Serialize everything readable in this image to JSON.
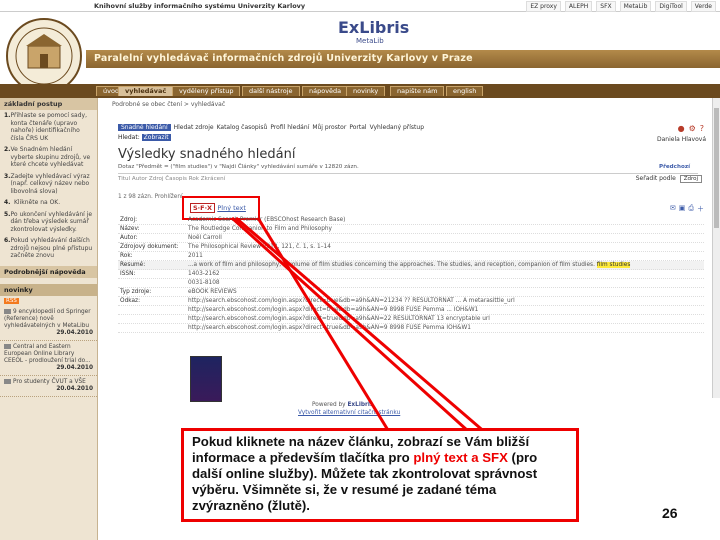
{
  "topbar": {
    "title": "Knihovní služby informačního systému Univerzity Karlovy",
    "links": [
      "EZ proxy",
      "ALEPH",
      "SFX",
      "MetaLib",
      "DigiTool",
      "Verde"
    ]
  },
  "header": {
    "brand": "ExLibris",
    "brand_sub": "MetaLib",
    "banner": "Paralelní vyhledávač informačních zdrojů Univerzity Karlovy v Praze"
  },
  "nav": {
    "tabs": [
      "úvod",
      "vyhledávač",
      "vydělený přístup",
      "další nástroje",
      "nápověda",
      "novinky",
      "napište nám",
      "english"
    ],
    "active_index": 1
  },
  "sidebar": {
    "heading": "základní postup",
    "steps": [
      {
        "n": "1.",
        "text": "Přihlaste se pomocí sady, konta čtenáře (upravo nahoře) identifikačního čísla ČRS UK"
      },
      {
        "n": "2.",
        "text": "Ve Snadném hledání vyberte skupinu zdrojů, ve které chcete vyhledávat"
      },
      {
        "n": "3.",
        "text": "Zadejte vyhledávací výraz (např. celkový název nebo libovolná slova)"
      },
      {
        "n": "4.",
        "text": "Klikněte na OK."
      },
      {
        "n": "5.",
        "text": "Po ukončení vyhledávání je dán třeba výsledek sumář zkontrolovat výsledky."
      },
      {
        "n": "6.",
        "text": "Pokud vyhledávání dalších zdrojů nejsou plné přístupu začněte znovu"
      }
    ],
    "help_heading": "Podrobnější nápověda",
    "news_heading": "novinky",
    "rss": "RSS",
    "news": [
      {
        "text": "9 encyklopedií od Springer (Reference) nově vyhledávatelných v MetaLibu",
        "date": "29.04.2010"
      },
      {
        "text": "Central and Eastern European Online Library CEEOL - prodloužení trial do...",
        "date": "29.04.2010"
      },
      {
        "text": "Pro studenty ČVUT a VŠE",
        "date": "20.04.2010"
      }
    ]
  },
  "main": {
    "breadcrumb": "Podrobné se obec čtení > vyhledávač",
    "view_links": [
      "Snadné hledání",
      "Hledat zdroje",
      "Katalog časopisů",
      "Profil hledání",
      "Můj prostor",
      "Portal",
      "Vyhledaný přístup"
    ],
    "hidden_label": "Hledat:",
    "hidden_box": "Zobrazit",
    "username": "Daniela Hlavová",
    "page_title": "Výsledky snadného hledání",
    "query_text": "Dotaz \"Předmět = (\"film studies\") v \"Najdi Články\" vyhledávání sumáře v 12820 zázn.",
    "prev_label": "Předchozí",
    "filter_text": "Titul Autor Zdroj Časopis Rok Zkrácení",
    "sort_label": "Seřadit podle",
    "sort_value": "Zdroj",
    "counts": "1 z 98 zázn. Prohlížení",
    "sfx_label": "S·F·X",
    "fulltext_label": "Plný text",
    "record": [
      {
        "label": "Zdroj:",
        "value": "Academic Search Premier (EBSCOhost Research Base)"
      },
      {
        "label": "Název:",
        "value": "The Routledge Companion to Film and Philosophy"
      },
      {
        "label": "Autor:",
        "value": "Noël Carroll"
      },
      {
        "label": "Zdrojový dokument:",
        "value": "The Philosophical Review 2012, 121, č. 1, s. 1–14"
      },
      {
        "label": "Rok:",
        "value": "2011"
      },
      {
        "label": "Resumé:",
        "value": "...a work of film and philosophy, a volume of film studies concerning the approaches. The studies, and reception, companion of film studies.",
        "highlight": "film studies"
      },
      {
        "label": "ISSN:",
        "value": "1403-2162"
      },
      {
        "label": "",
        "value": "0031-8108"
      },
      {
        "label": "Typ zdroje:",
        "value": "eBOOK REVIEWS"
      },
      {
        "label": "Odkaz:",
        "value": "http://search.ebscohost.com/login.aspx?direct=true&db=a9h&AN=21234 ?? RESULTORNAT ... A metarasittle_url"
      },
      {
        "label": "",
        "value": "http://search.ebscohost.com/login.aspx?direct=true&db=a9h&AN=9 8998 FUSE Pemma ... IOH&W1"
      },
      {
        "label": "",
        "value": "http://search.ebscohost.com/login.aspx?direct=true&db=a9h&AN=22 RESULTORNAT 13 encryptable url"
      },
      {
        "label": "",
        "value": "http://search.ebscohost.com/login.aspx?direct=true&db=a9h&AN=9 8998 FUSE Pemma IOH&W1"
      }
    ],
    "powered_by": "Powered by",
    "powered_brand": "ExLibris",
    "rl_link": "Vytvořit alternativní citační stránku"
  },
  "annotation": {
    "text_1": "Pokud kliknete na název článku, zobrazí se Vám bližší informace a především tlačítka pro ",
    "text_red": "plný text a SFX",
    "text_2": " (pro další online služby). Můžete tak zkontrolovat správnost výběru. Všimněte si, že v resumé je zadané téma zvýrazněno (žlutě).",
    "slide_number": "26",
    "color": "#e00000"
  }
}
